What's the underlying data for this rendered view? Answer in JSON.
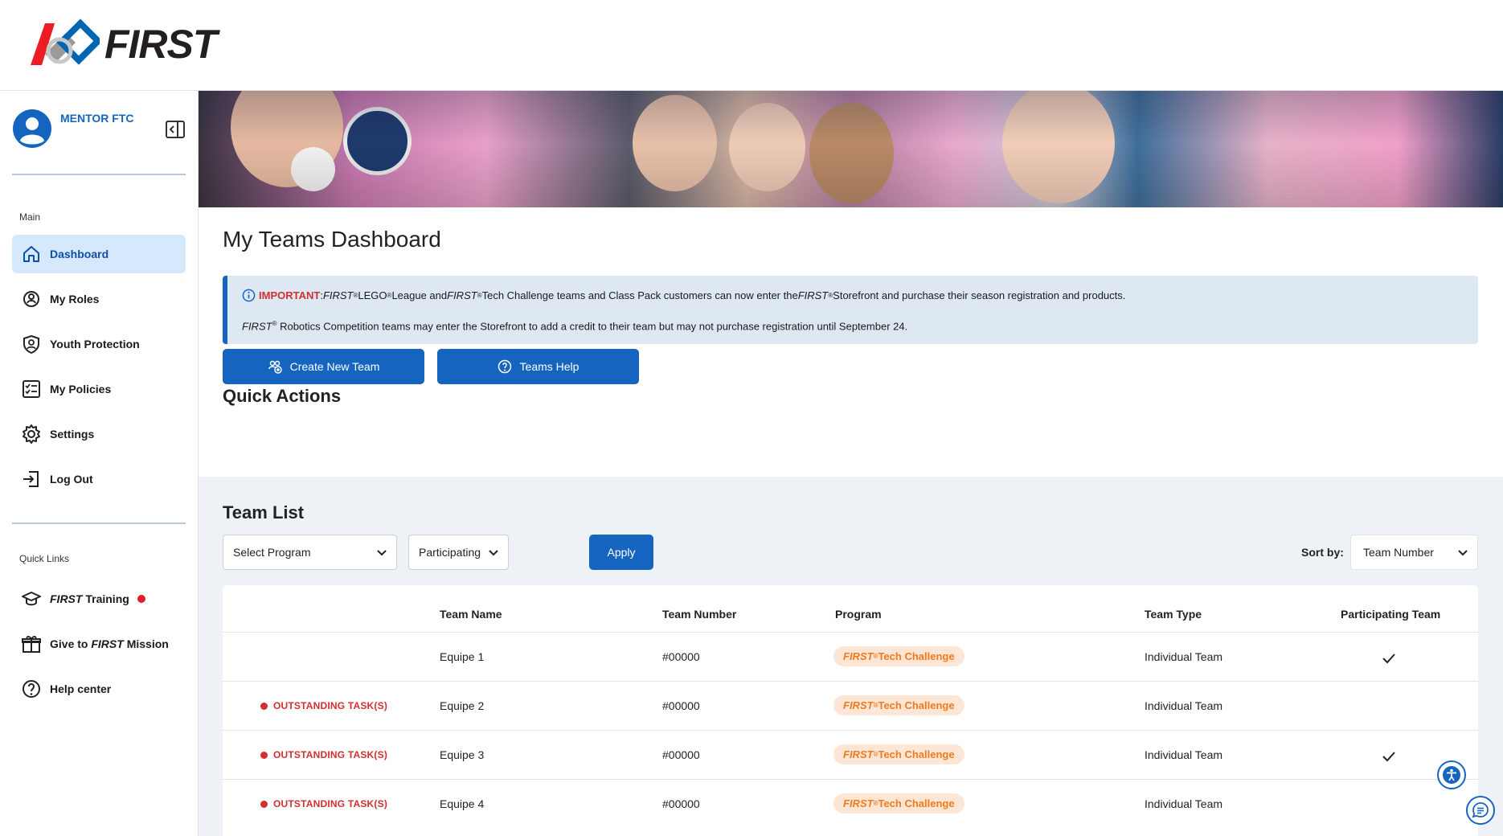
{
  "brand": {
    "logo_text": "FIRST",
    "accent": "#1565c0",
    "alert_red": "#d32f2f"
  },
  "user": {
    "name": "MENTOR FTC"
  },
  "sidebar": {
    "main_label": "Main",
    "items": [
      {
        "label": "Dashboard",
        "icon": "home-icon"
      },
      {
        "label": "My Roles",
        "icon": "roles-icon"
      },
      {
        "label": "Youth Protection",
        "icon": "shield-icon"
      },
      {
        "label": "My Policies",
        "icon": "checklist-icon"
      },
      {
        "label": "Settings",
        "icon": "gear-icon"
      },
      {
        "label": "Log Out",
        "icon": "logout-icon"
      }
    ],
    "quick_links_label": "Quick Links",
    "quick_links": {
      "training_first": "FIRST",
      "training_rest": " Training",
      "give_pre": "Give to ",
      "give_first": "FIRST",
      "give_rest": " Mission",
      "help": "Help center"
    }
  },
  "page": {
    "title": "My Teams Dashboard"
  },
  "notice": {
    "important": "IMPORTANT",
    "p1": ": ",
    "first": "FIRST",
    "reg": "®",
    "p2": " LEGO",
    "p3": " League and ",
    "p4": " Tech Challenge teams and Class Pack customers can now enter the ",
    "p5": " Storefront and purchase their season registration and products.",
    "line2_rest": " Robotics Competition teams may enter the Storefront to add a credit to their team but may not purchase registration until September 24."
  },
  "quick_actions": {
    "title": "Quick Actions",
    "create": "Create New Team",
    "help": "Teams Help"
  },
  "team_list": {
    "title": "Team List",
    "program_select": "Select Program",
    "status_select": "Participating",
    "apply": "Apply",
    "sort_label": "Sort by:",
    "sort_value": "Team Number",
    "columns": {
      "name": "Team Name",
      "number": "Team Number",
      "program": "Program",
      "type": "Team Type",
      "participating": "Participating Team"
    },
    "outstanding_label": "OUTSTANDING TASK(S)",
    "program_first": "FIRST",
    "program_rest": " Tech Challenge",
    "rows": [
      {
        "name": "Equipe 1",
        "number": "#00000",
        "type": "Individual Team"
      },
      {
        "name": "Equipe 2",
        "number": "#00000",
        "type": "Individual Team"
      },
      {
        "name": "Equipe 3",
        "number": "#00000",
        "type": "Individual Team"
      },
      {
        "name": "Equipe 4",
        "number": "#00000",
        "type": "Individual Team"
      }
    ]
  }
}
